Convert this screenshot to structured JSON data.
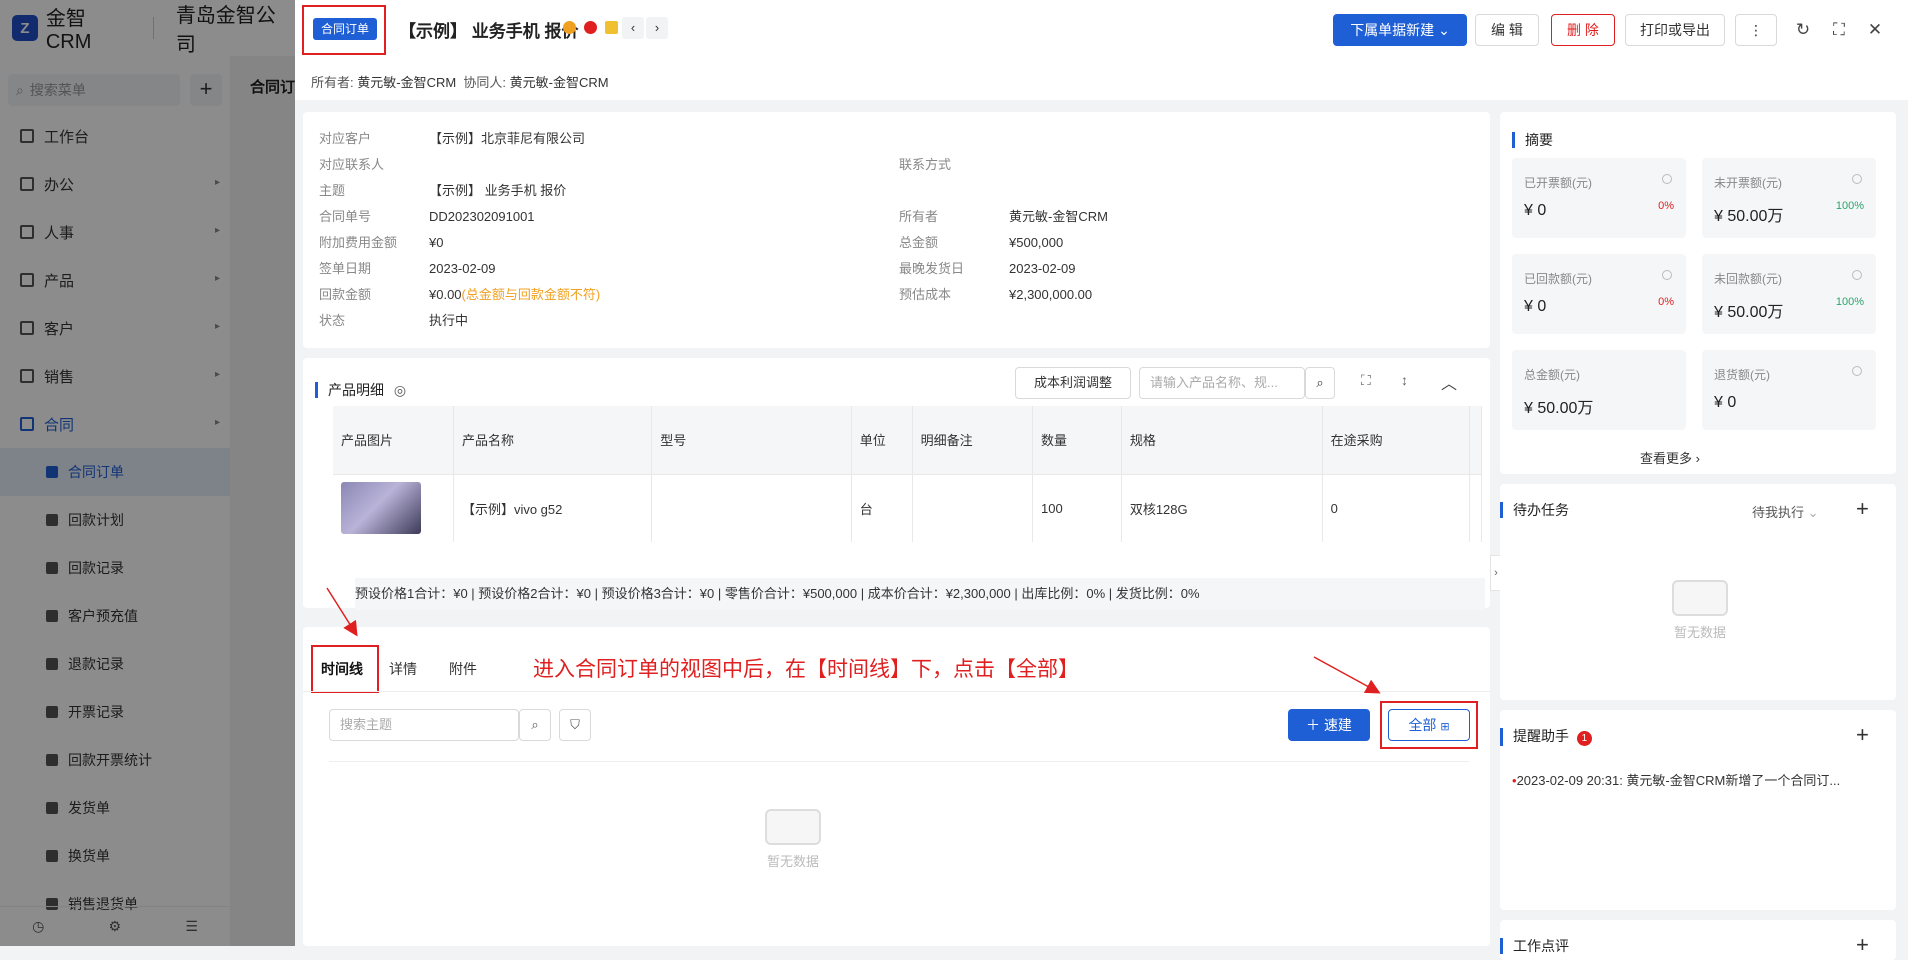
{
  "app": {
    "brand": "金智CRM",
    "company": "青岛金智公司",
    "search_placeholder": "搜索菜单"
  },
  "sidebar": {
    "items": [
      {
        "label": "工作台"
      },
      {
        "label": "办公"
      },
      {
        "label": "人事"
      },
      {
        "label": "产品"
      },
      {
        "label": "客户"
      },
      {
        "label": "销售"
      },
      {
        "label": "合同"
      }
    ],
    "sub_items": [
      {
        "label": "合同订单"
      },
      {
        "label": "回款计划"
      },
      {
        "label": "回款记录"
      },
      {
        "label": "客户预充值"
      },
      {
        "label": "退款记录"
      },
      {
        "label": "开票记录"
      },
      {
        "label": "回款开票统计"
      },
      {
        "label": "发货单"
      },
      {
        "label": "换货单"
      },
      {
        "label": "销售退货单"
      }
    ]
  },
  "background": {
    "list_title": "合同订"
  },
  "header": {
    "doc_type": "合同订单",
    "title": "【示例】 业务手机 报价",
    "owner_label": "所有者:",
    "owner": "黄元敏-金智CRM",
    "collab_label": "协同人:",
    "collab": "黄元敏-金智CRM",
    "new_sub_btn": "下属单据新建",
    "edit_btn": "编 辑",
    "delete_btn": "删 除",
    "print_btn": "打印或导出"
  },
  "info": {
    "rows_left": [
      {
        "k": "对应客户",
        "v": "【示例】北京菲尼有限公司"
      },
      {
        "k": "对应联系人",
        "v": ""
      },
      {
        "k": "主题",
        "v": "【示例】 业务手机 报价"
      },
      {
        "k": "合同单号",
        "v": "DD202302091001"
      },
      {
        "k": "附加费用金额",
        "v": "¥0"
      },
      {
        "k": "签单日期",
        "v": "2023-02-09"
      },
      {
        "k": "回款金额",
        "v": "¥0.00",
        "warn": "(总金额与回款金额不符)"
      },
      {
        "k": "状态",
        "v": "执行中"
      }
    ],
    "rows_right": [
      {
        "k": "联系方式",
        "v": ""
      },
      {
        "k": "所有者",
        "v": "黄元敏-金智CRM"
      },
      {
        "k": "总金额",
        "v": "¥500,000"
      },
      {
        "k": "最晚发货日",
        "v": "2023-02-09"
      },
      {
        "k": "预估成本",
        "v": "¥2,300,000.00"
      }
    ]
  },
  "products": {
    "title": "产品明细",
    "adjust_btn": "成本利润调整",
    "search_placeholder": "请输入产品名称、规...",
    "columns": [
      "产品图片",
      "产品名称",
      "型号",
      "单位",
      "明细备注",
      "数量",
      "规格",
      "在途采购"
    ],
    "rows": [
      {
        "name": "【示例】vivo g52",
        "model": "",
        "unit": "台",
        "note": "",
        "qty": "100",
        "spec": "双核128G",
        "transit": "0"
      }
    ],
    "summary": "预设价格1合计：¥0 |   预设价格2合计：¥0 |   预设价格3合计：¥0 |   零售价合计：¥500,000 |   成本价合计：¥2,300,000 |   出库比例：0% |   发货比例：0%"
  },
  "timeline": {
    "tabs": [
      "时间线",
      "详情",
      "附件"
    ],
    "annotation": "进入合同订单的视图中后，在【时间线】下，点击【全部】",
    "search_placeholder": "搜索主题",
    "new_btn": "速建",
    "all_btn": "全部",
    "empty": "暂无数据"
  },
  "summary_panel": {
    "title": "摘要",
    "cards": [
      {
        "label": "已开票额(元)",
        "value": "¥ 0",
        "pct": "0%",
        "pct_color": "#e02020"
      },
      {
        "label": "未开票额(元)",
        "value": "¥ 50.00万",
        "pct": "100%",
        "pct_color": "#2aa56a"
      },
      {
        "label": "已回款额(元)",
        "value": "¥ 0",
        "pct": "0%",
        "pct_color": "#e02020"
      },
      {
        "label": "未回款额(元)",
        "value": "¥ 50.00万",
        "pct": "100%",
        "pct_color": "#2aa56a"
      },
      {
        "label": "总金额(元)",
        "value": "¥ 50.00万",
        "pct": "",
        "pct_color": ""
      },
      {
        "label": "退货额(元)",
        "value": "¥ 0",
        "pct": "",
        "pct_color": ""
      }
    ],
    "more": "查看更多"
  },
  "todo": {
    "title": "待办任务",
    "filter": "待我执行",
    "empty": "暂无数据"
  },
  "reminder": {
    "title": "提醒助手",
    "badge": "1",
    "item": "2023-02-09 20:31: 黄元敏-金智CRM新增了一个合同订..."
  },
  "bottom_panel": {
    "title": "工作点评"
  },
  "colors": {
    "primary": "#1f5fd6",
    "danger": "#e02020",
    "warning": "#f0a020",
    "success": "#2aa56a"
  }
}
